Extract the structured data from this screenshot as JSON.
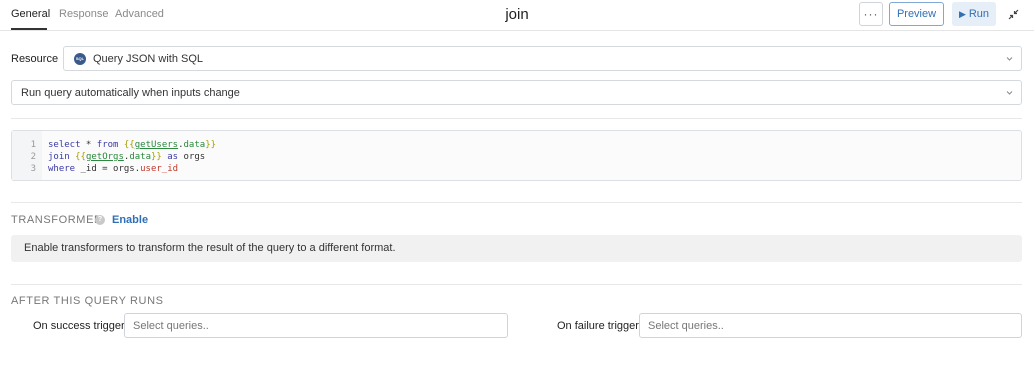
{
  "header": {
    "tabs": [
      {
        "label": "General",
        "active": true
      },
      {
        "label": "Response",
        "active": false
      },
      {
        "label": "Advanced",
        "active": false
      }
    ],
    "query_name": "join",
    "more_label": "···",
    "preview_label": "Preview",
    "run_label": "Run"
  },
  "resource": {
    "label": "Resource",
    "badge": "SQL",
    "value": "Query JSON with SQL"
  },
  "trigger_mode": {
    "value": "Run query automatically when inputs change"
  },
  "editor": {
    "line_numbers": [
      "1",
      "2",
      "3"
    ],
    "lines": [
      [
        {
          "t": "select",
          "c": "kw"
        },
        {
          "t": " * ",
          "c": "plain"
        },
        {
          "t": "from",
          "c": "kw"
        },
        {
          "t": " ",
          "c": "plain"
        },
        {
          "t": "{{",
          "c": "br"
        },
        {
          "t": "getUsers",
          "c": "id"
        },
        {
          "t": ".",
          "c": "plain"
        },
        {
          "t": "data",
          "c": "prop"
        },
        {
          "t": "}}",
          "c": "br"
        }
      ],
      [
        {
          "t": "join",
          "c": "kw"
        },
        {
          "t": " ",
          "c": "plain"
        },
        {
          "t": "{{",
          "c": "br"
        },
        {
          "t": "getOrgs",
          "c": "id"
        },
        {
          "t": ".",
          "c": "plain"
        },
        {
          "t": "data",
          "c": "prop"
        },
        {
          "t": "}}",
          "c": "br"
        },
        {
          "t": " ",
          "c": "plain"
        },
        {
          "t": "as",
          "c": "kw"
        },
        {
          "t": " orgs",
          "c": "plain"
        }
      ],
      [
        {
          "t": "where",
          "c": "kw"
        },
        {
          "t": " _id = orgs.",
          "c": "plain"
        },
        {
          "t": "user_id",
          "c": "red"
        }
      ]
    ]
  },
  "transformer": {
    "title": "TRANSFORMER",
    "help": "?",
    "enable_label": "Enable",
    "info": "Enable transformers to transform the result of the query to a different format."
  },
  "after_runs": {
    "title": "AFTER THIS QUERY RUNS",
    "success_label": "On success trigger",
    "success_placeholder": "Select queries..",
    "failure_label": "On failure trigger",
    "failure_placeholder": "Select queries.."
  },
  "colors": {
    "accent": "#3170b5",
    "link": "#2f6fb7",
    "info_bg": "#f1f1f1"
  },
  "icons": {
    "collapse": "collapse-arrows-icon",
    "chevron": "chevron-down-icon",
    "play": "play-icon",
    "help": "help-circle-icon",
    "sql": "sql-badge-icon"
  }
}
